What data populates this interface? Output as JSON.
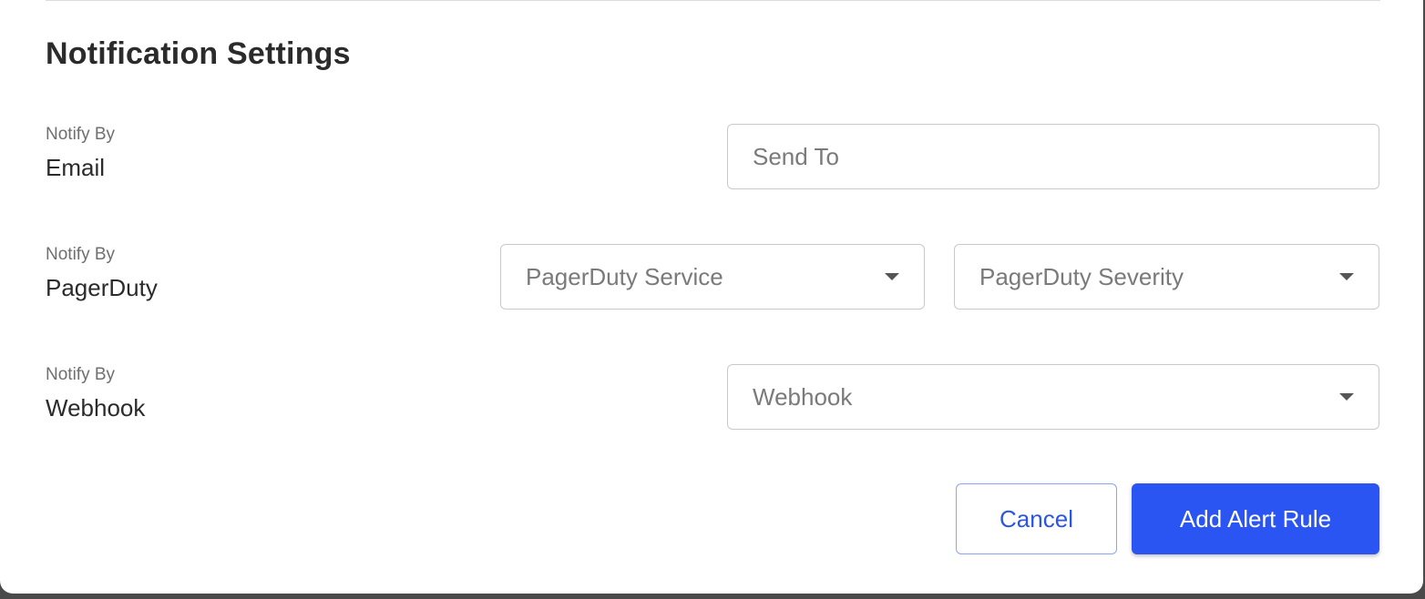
{
  "section": {
    "title": "Notification Settings"
  },
  "rows": [
    {
      "caption": "Notify By",
      "channel": "Email",
      "send_to_placeholder": "Send To"
    },
    {
      "caption": "Notify By",
      "channel": "PagerDuty",
      "service_placeholder": "PagerDuty Service",
      "severity_placeholder": "PagerDuty Severity"
    },
    {
      "caption": "Notify By",
      "channel": "Webhook",
      "webhook_placeholder": "Webhook"
    }
  ],
  "actions": {
    "cancel_label": "Cancel",
    "submit_label": "Add Alert Rule"
  },
  "colors": {
    "primary": "#2a55f2",
    "cancel_text": "#2a55e5",
    "cancel_border": "#8aa3f5"
  },
  "icons": {
    "dropdown": "caret-down-icon"
  }
}
